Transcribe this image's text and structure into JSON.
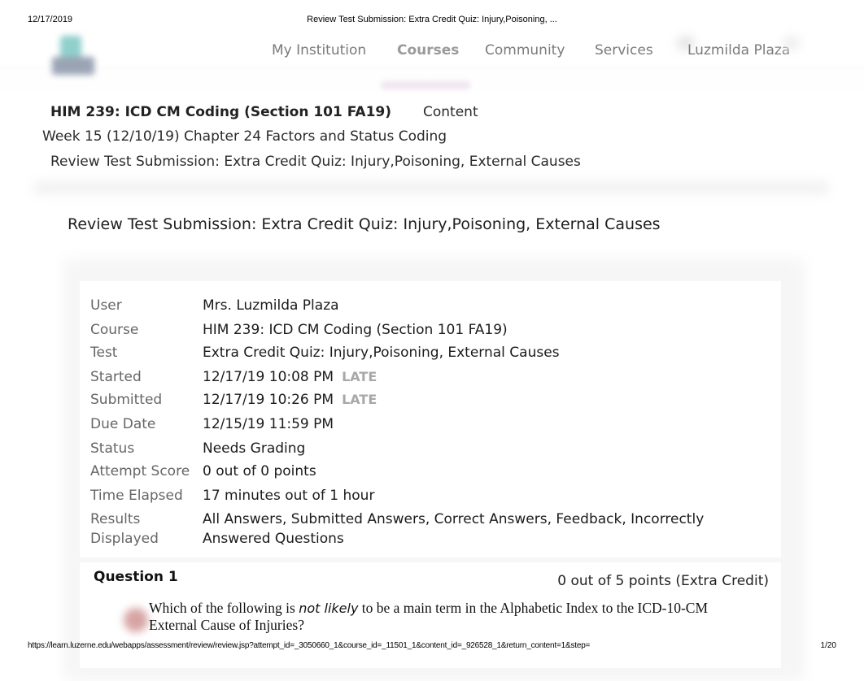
{
  "print_header": {
    "date": "12/17/2019",
    "title": "Review Test Submission: Extra Credit Quiz: Injury,Poisoning, ..."
  },
  "print_footer": {
    "url": "https://learn.luzerne.edu/webapps/assessment/review/review.jsp?attempt_id=_3050660_1&course_id=_11501_1&content_id=_926528_1&return_content=1&step=",
    "page": "1/20"
  },
  "topnav": {
    "items": [
      {
        "label": "My Institution",
        "active": false
      },
      {
        "label": "Courses",
        "active": true
      },
      {
        "label": "Community",
        "active": false
      },
      {
        "label": "Services",
        "active": false
      }
    ],
    "user_name": "Luzmilda Plaza"
  },
  "breadcrumb": {
    "course": "HIM 239: ICD CM Coding (Section 101 FA19)",
    "content": "Content",
    "week": "Week 15 (12/10/19) Chapter 24 Factors and Status Coding",
    "current": "Review Test Submission: Extra Credit Quiz: Injury,Poisoning, External Causes"
  },
  "page_title": "Review Test Submission: Extra Credit Quiz: Injury,Poisoning, External Causes",
  "details": [
    {
      "label": "User",
      "value": "Mrs. Luzmilda Plaza"
    },
    {
      "label": "Course",
      "value": "HIM 239: ICD CM Coding (Section 101 FA19)"
    },
    {
      "label": "Test",
      "value": "Extra Credit Quiz: Injury,Poisoning, External Causes"
    },
    {
      "label": "Started",
      "value": "12/17/19 10:08 PM",
      "badge": "LATE"
    },
    {
      "label": "Submitted",
      "value": "12/17/19 10:26 PM",
      "badge": "LATE"
    },
    {
      "label": "Due Date",
      "value": "12/15/19 11:59 PM"
    },
    {
      "label": "Status",
      "value": "Needs Grading"
    },
    {
      "label": "Attempt Score",
      "value": "0 out of 0 points"
    },
    {
      "label": "Time Elapsed",
      "value": "17 minutes out of 1 hour"
    },
    {
      "label": "Results Displayed",
      "value": "All Answers, Submitted Answers, Correct Answers, Feedback, Incorrectly Answered Questions"
    }
  ],
  "question": {
    "title": "Question 1",
    "points": "0 out of 5 points (Extra Credit)",
    "icon": "incorrect-icon",
    "text_before": "Which of the following is ",
    "text_emphasis": "not likely",
    "text_after": " to be a main term in the Alphabetic Index to the ICD-10-CM External Cause of Injuries?"
  }
}
